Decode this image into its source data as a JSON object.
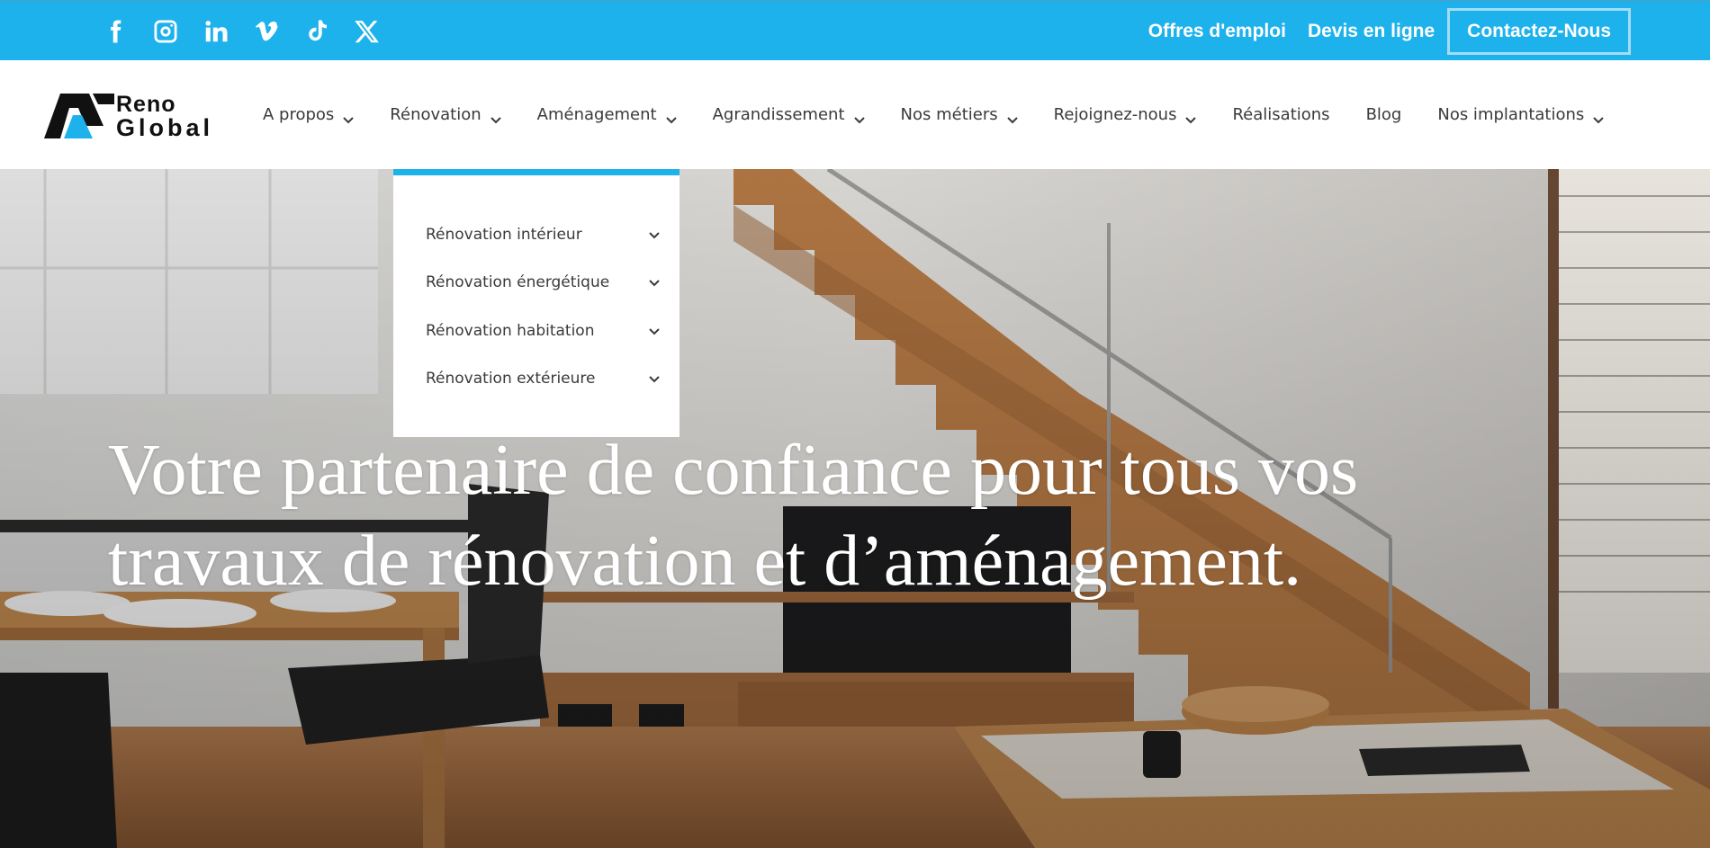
{
  "colors": {
    "accent": "#1eb2ec",
    "text": "#3a3a3a",
    "white": "#ffffff"
  },
  "topbar": {
    "social_icons": [
      "facebook-icon",
      "instagram-icon",
      "linkedin-icon",
      "vimeo-icon",
      "tiktok-icon",
      "x-icon"
    ],
    "links": [
      "Offres d'emploi",
      "Devis en ligne"
    ],
    "contact_label": "Contactez-Nous"
  },
  "logo": {
    "line1": "Reno",
    "line2": "Global"
  },
  "nav": {
    "items": [
      {
        "label": "A propos",
        "dropdown": true
      },
      {
        "label": "Rénovation",
        "dropdown": true
      },
      {
        "label": "Aménagement",
        "dropdown": true
      },
      {
        "label": "Agrandissement",
        "dropdown": true
      },
      {
        "label": "Nos métiers",
        "dropdown": true
      },
      {
        "label": "Rejoignez-nous",
        "dropdown": true
      },
      {
        "label": "Réalisations",
        "dropdown": false
      },
      {
        "label": "Blog",
        "dropdown": false
      },
      {
        "label": "Nos implantations",
        "dropdown": true
      }
    ]
  },
  "dropdown": {
    "items": [
      "Rénovation intérieur",
      "Rénovation énergétique",
      "Rénovation habitation",
      "Rénovation extérieure"
    ]
  },
  "hero": {
    "title": "Votre partenaire de confiance pour tous vos travaux de rénovation et d’aménagement."
  }
}
